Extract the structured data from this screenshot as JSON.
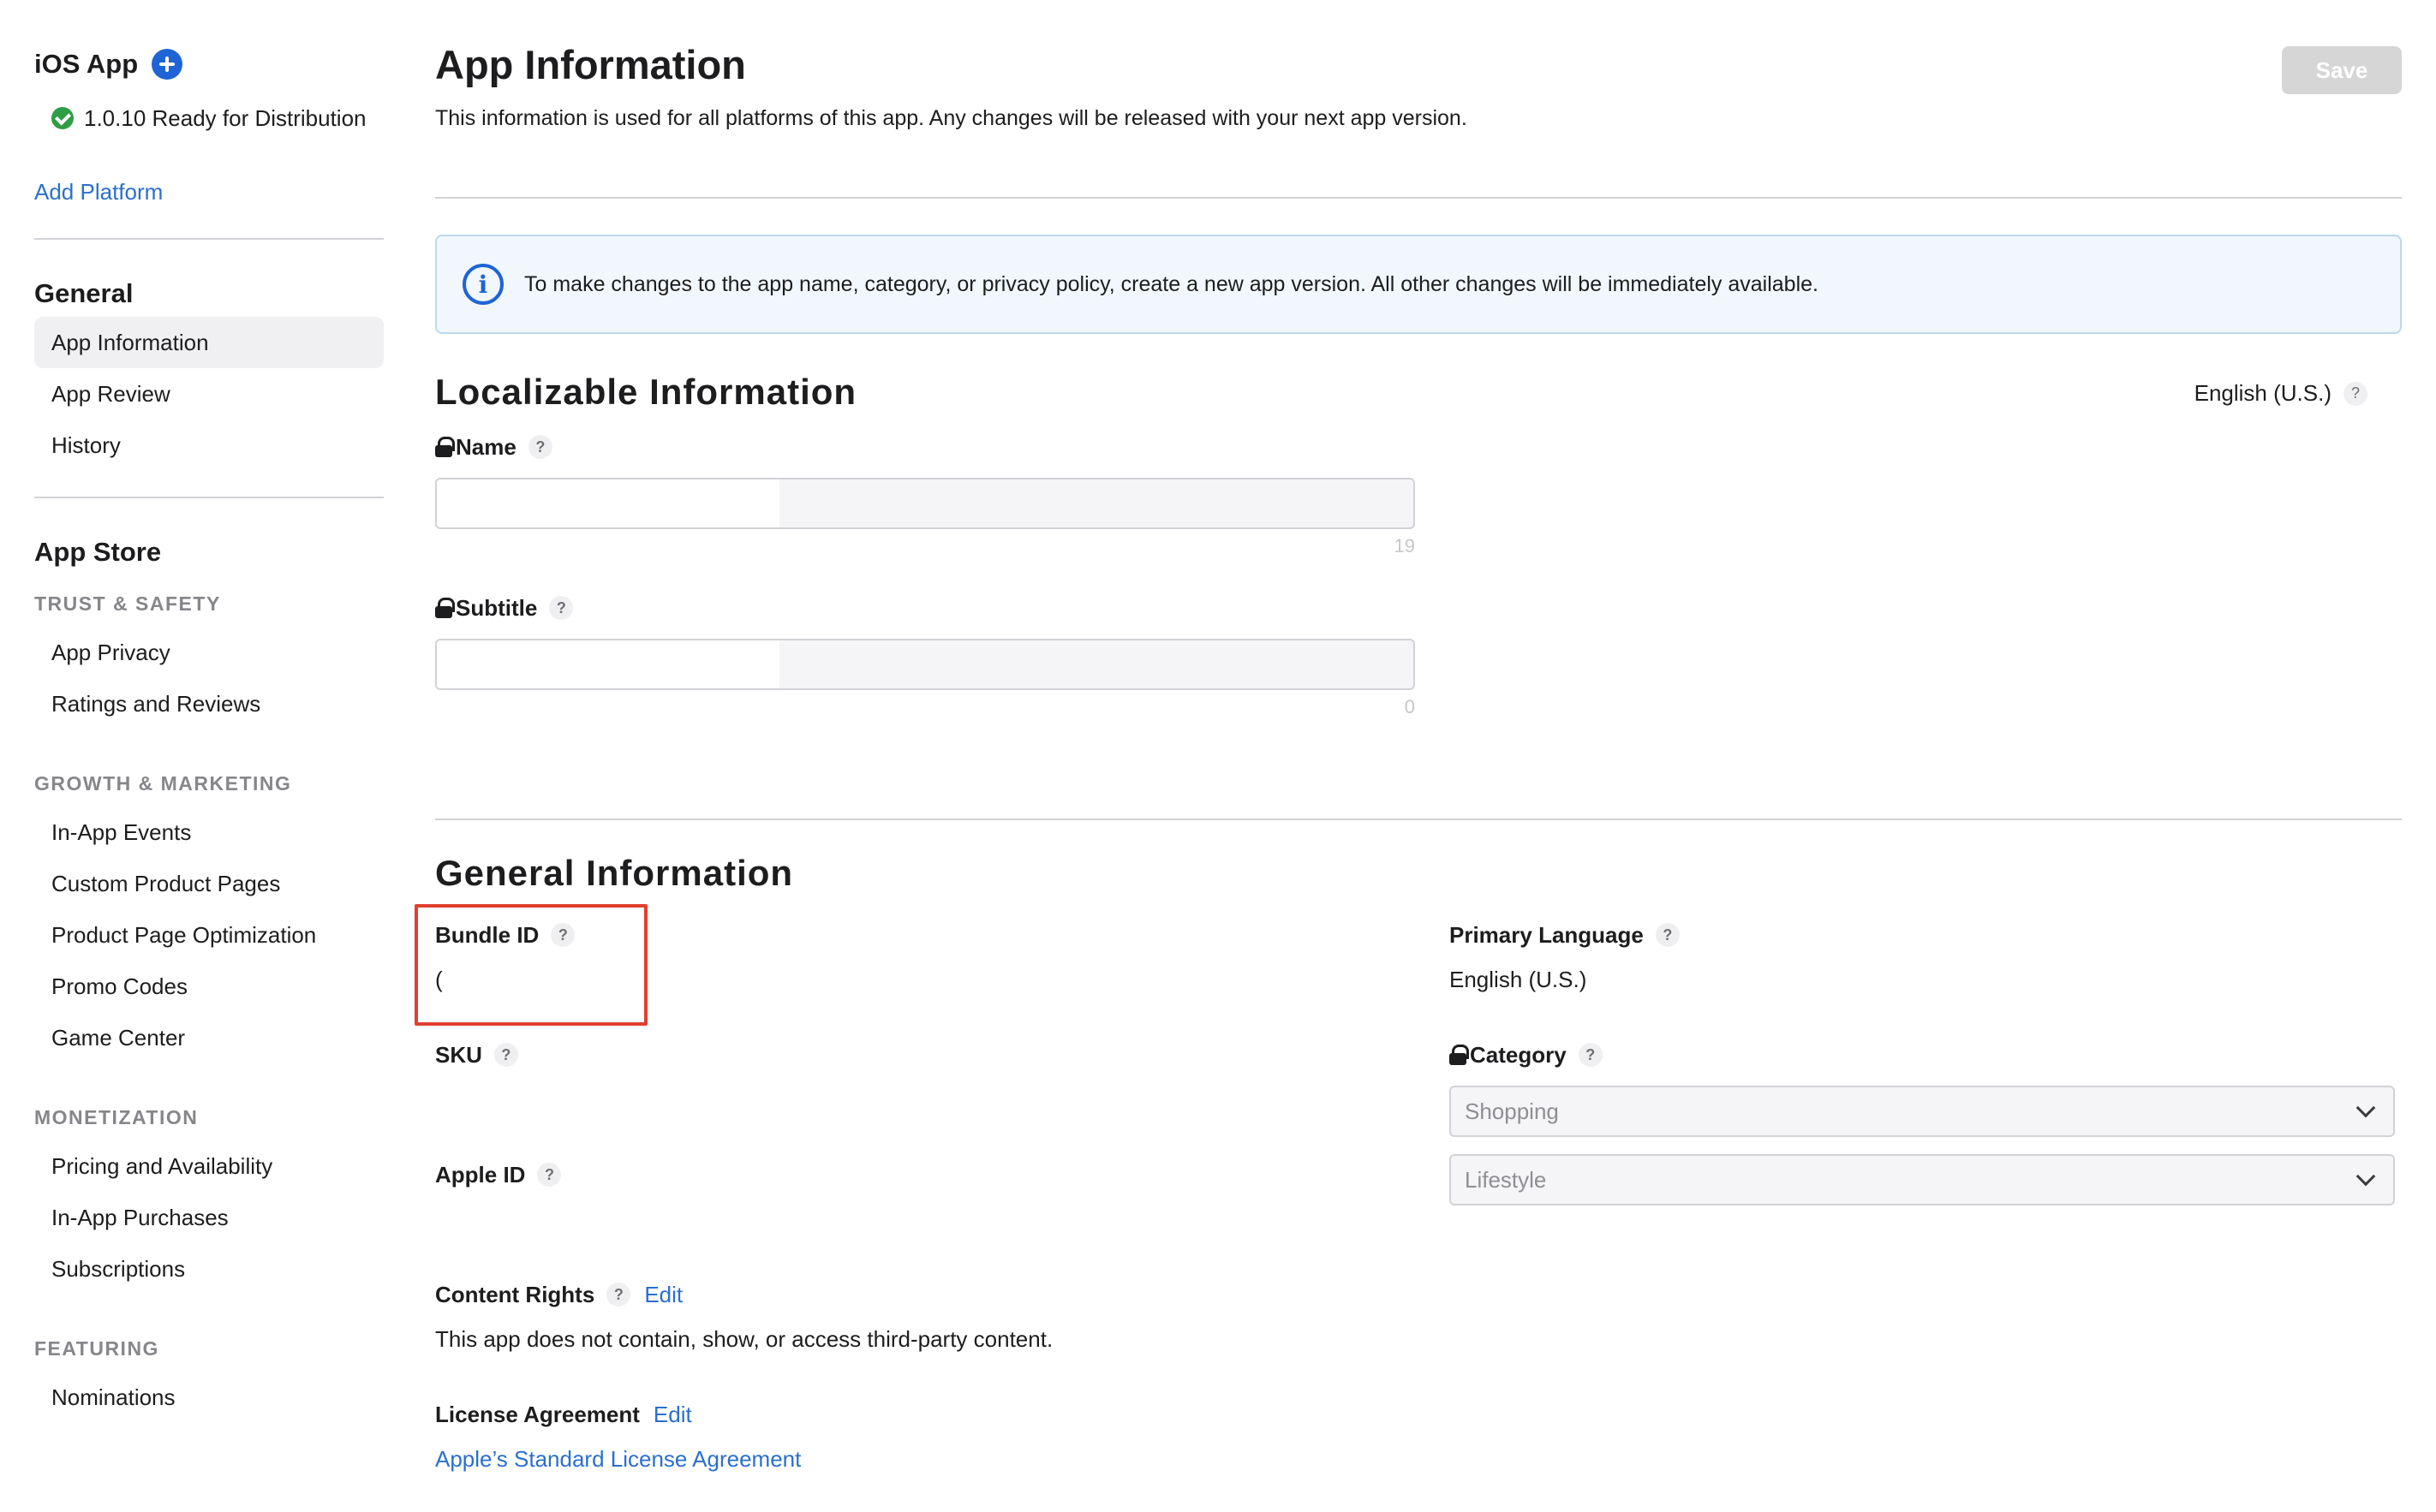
{
  "sidebar": {
    "platform_title": "iOS App",
    "version_status": "1.0.10 Ready for Distribution",
    "add_platform": "Add Platform",
    "general": {
      "title": "General",
      "items": [
        "App Information",
        "App Review",
        "History"
      ]
    },
    "app_store": {
      "title": "App Store",
      "groups": [
        {
          "title": "TRUST & SAFETY",
          "items": [
            "App Privacy",
            "Ratings and Reviews"
          ]
        },
        {
          "title": "GROWTH & MARKETING",
          "items": [
            "In-App Events",
            "Custom Product Pages",
            "Product Page Optimization",
            "Promo Codes",
            "Game Center"
          ]
        },
        {
          "title": "MONETIZATION",
          "items": [
            "Pricing and Availability",
            "In-App Purchases",
            "Subscriptions"
          ]
        },
        {
          "title": "FEATURING",
          "items": [
            "Nominations"
          ]
        }
      ]
    }
  },
  "header": {
    "title": "App Information",
    "description": "This information is used for all platforms of this app. Any changes will be released with your next app version.",
    "save_label": "Save"
  },
  "banner": {
    "icon": "info-icon",
    "text": "To make changes to the app name, category, or privacy policy, create a new app version. All other changes will be immediately available."
  },
  "localizable": {
    "title": "Localizable Information",
    "language": "English (U.S.)",
    "name": {
      "label": "Name",
      "value": "",
      "count": "19"
    },
    "subtitle": {
      "label": "Subtitle",
      "value": "",
      "count": "0"
    }
  },
  "general_info": {
    "title": "General Information",
    "bundle_id": {
      "label": "Bundle ID",
      "value": "("
    },
    "sku": {
      "label": "SKU",
      "value": ""
    },
    "apple_id": {
      "label": "Apple ID",
      "value": ""
    },
    "content_rights": {
      "label": "Content Rights",
      "edit": "Edit",
      "value": "This app does not contain, show, or access third-party content."
    },
    "license": {
      "label": "License Agreement",
      "edit": "Edit",
      "link": "Apple’s Standard License Agreement"
    },
    "primary_language": {
      "label": "Primary Language",
      "value": "English (U.S.)"
    },
    "category": {
      "label": "Category",
      "primary": "Shopping",
      "secondary": "Lifestyle"
    }
  },
  "help_glyph": "?",
  "colors": {
    "accent": "#1e64d6",
    "link": "#2a6fce",
    "success": "#2e9d45",
    "highlight": "#e0402e"
  }
}
